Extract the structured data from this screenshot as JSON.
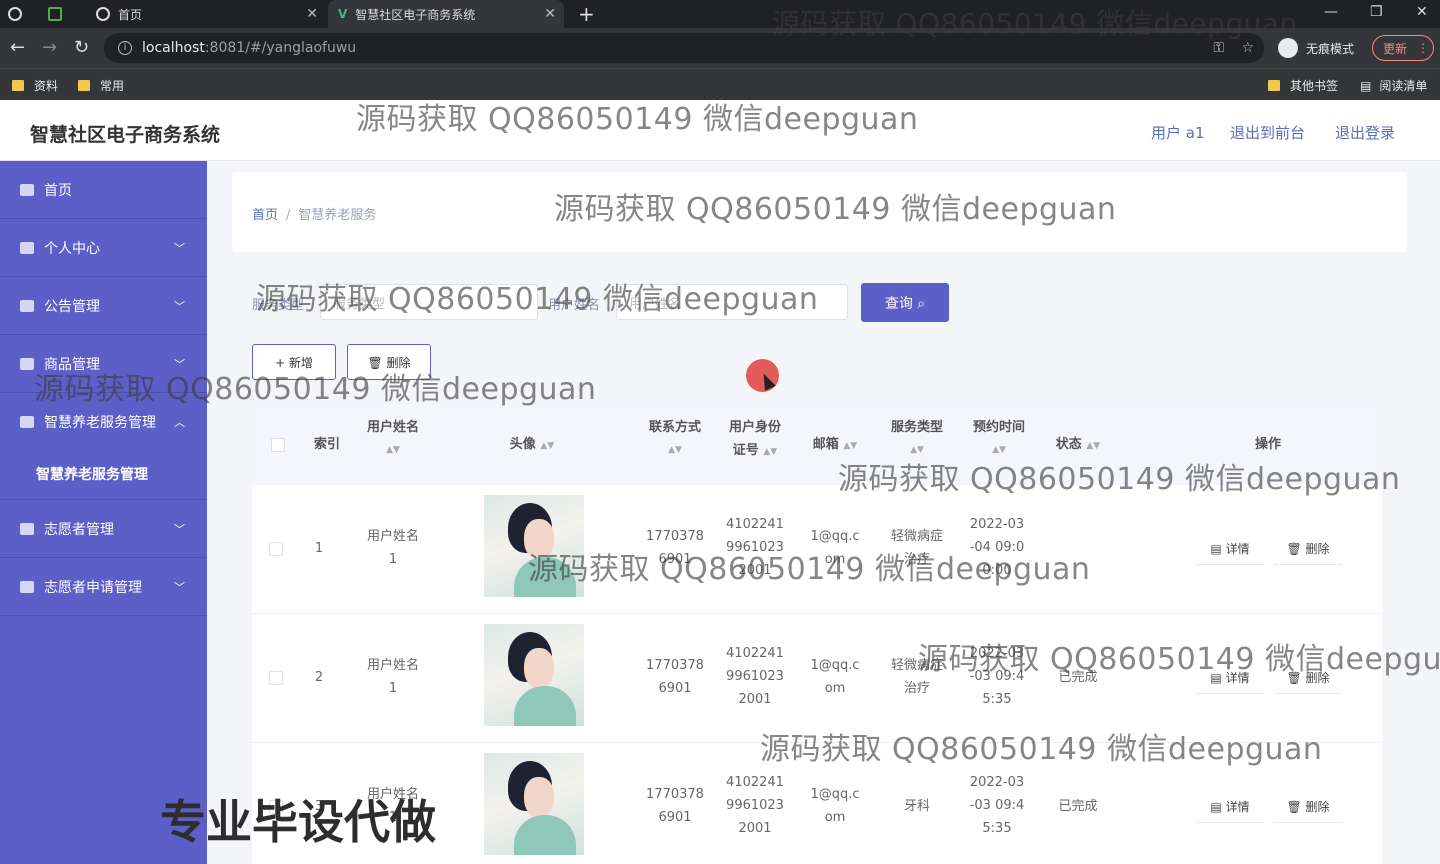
{
  "browser": {
    "tabs": [
      {
        "label": "首页"
      },
      {
        "label": "智慧社区电子商务系统"
      }
    ],
    "url_host": "localhost",
    "url_path": ":8081/#/yanglaofuwu",
    "incognito_label": "无痕模式",
    "update_label": "更新",
    "bookmarks_left": [
      "资料",
      "常用"
    ],
    "bookmarks_right": [
      "其他书签",
      "阅读清单"
    ]
  },
  "header": {
    "title": "智慧社区电子商务系统",
    "user": "用户 a1",
    "front_link": "退出到前台",
    "logout": "退出登录"
  },
  "sidebar": {
    "items": [
      {
        "label": "首页"
      },
      {
        "label": "个人中心"
      },
      {
        "label": "公告管理"
      },
      {
        "label": "商品管理"
      },
      {
        "label": "智慧养老服务管理"
      },
      {
        "label": "智慧养老服务管理"
      },
      {
        "label": "志愿者管理"
      },
      {
        "label": "志愿者申请管理"
      }
    ]
  },
  "breadcrumb": {
    "home": "首页",
    "sep": "/",
    "current": "智慧养老服务"
  },
  "search": {
    "service_type_label": "服务类型",
    "service_type_placeholder": "服务类型",
    "username_label": "用户姓名",
    "username_placeholder": "用户姓名",
    "query_label": "查询 ⌕"
  },
  "toolbar": {
    "add_label": "+ 新增",
    "delete_label": "🗑 删除"
  },
  "table": {
    "headers": {
      "index": "索引",
      "username": "用户姓名",
      "avatar": "头像",
      "phone": "联系方式",
      "idcard_1": "用户身份",
      "idcard_2": "证号",
      "email": "邮箱",
      "service_type": "服务类型",
      "reserve_time": "预约时间",
      "status": "状态",
      "ops": "操作"
    },
    "rows": [
      {
        "index": "1",
        "name_1": "用户姓名",
        "name_2": "1",
        "phone_1": "1770378",
        "phone_2": "6901",
        "id_1": "4102241",
        "id_2": "9961023",
        "id_3": "2001",
        "email_1": "1@qq.c",
        "email_2": "om",
        "type_1": "轻微病症",
        "type_2": "治疗",
        "time_1": "2022-03",
        "time_2": "-04 09:0",
        "time_3": "0:00",
        "status": ""
      },
      {
        "index": "2",
        "name_1": "用户姓名",
        "name_2": "1",
        "phone_1": "1770378",
        "phone_2": "6901",
        "id_1": "4102241",
        "id_2": "9961023",
        "id_3": "2001",
        "email_1": "1@qq.c",
        "email_2": "om",
        "type_1": "轻微病症",
        "type_2": "治疗",
        "time_1": "2022-03",
        "time_2": "-03 09:4",
        "time_3": "5:35",
        "status": "已完成"
      },
      {
        "index": "3",
        "name_1": "用户姓名",
        "name_2": "1",
        "phone_1": "1770378",
        "phone_2": "6901",
        "id_1": "4102241",
        "id_2": "9961023",
        "id_3": "2001",
        "email_1": "1@qq.c",
        "email_2": "om",
        "type_1": "牙科",
        "type_2": "",
        "time_1": "2022-03",
        "time_2": "-03 09:4",
        "time_3": "5:35",
        "status": "已完成"
      }
    ],
    "detail_label": "▤ 详情",
    "delete_label": "🗑 删除"
  },
  "watermark": {
    "text": "源码获取 QQ86050149 微信deepguan",
    "big": "专业毕设代做"
  }
}
